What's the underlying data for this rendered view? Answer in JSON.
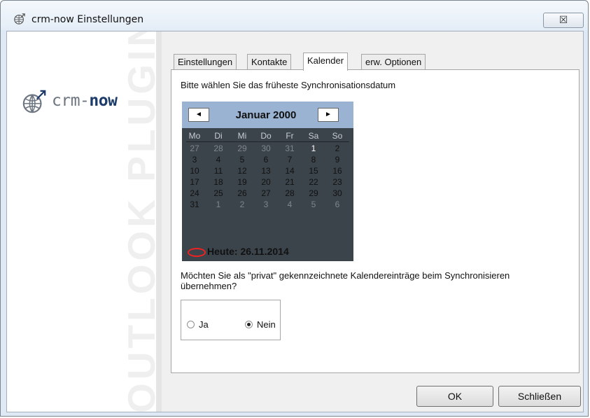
{
  "window": {
    "title": "crm-now Einstellungen",
    "close_glyph": "☒"
  },
  "sidebar": {
    "logo_text_main": "crm-",
    "logo_text_bold": "now",
    "vertical_text": "OUTLOOK PLUGIN",
    "logo_icon": "globe-arrow-icon"
  },
  "tabs": [
    {
      "label": "Einstellungen",
      "active": false
    },
    {
      "label": "Kontakte",
      "active": false
    },
    {
      "label": "Kalender",
      "active": true
    },
    {
      "label": "erw. Optionen",
      "active": false
    }
  ],
  "calendar_section": {
    "prompt": "Bitte wählen Sie das früheste Synchronisationsdatum",
    "month_label": "Januar 2000",
    "prev_glyph": "◄",
    "next_glyph": "►",
    "weekdays": [
      "Mo",
      "Di",
      "Mi",
      "Do",
      "Fr",
      "Sa",
      "So"
    ],
    "weeks": [
      [
        "27",
        "28",
        "29",
        "30",
        "31",
        "1",
        "2"
      ],
      [
        "3",
        "4",
        "5",
        "6",
        "7",
        "8",
        "9"
      ],
      [
        "10",
        "11",
        "12",
        "13",
        "14",
        "15",
        "16"
      ],
      [
        "17",
        "18",
        "19",
        "20",
        "21",
        "22",
        "23"
      ],
      [
        "24",
        "25",
        "26",
        "27",
        "28",
        "29",
        "30"
      ],
      [
        "31",
        "1",
        "2",
        "3",
        "4",
        "5",
        "6"
      ]
    ],
    "selected_date": "1",
    "today_label": "Heute: 26.11.2014",
    "colors": {
      "background": "#3b434b",
      "header": "#9ab3d2",
      "today_marker": "#e22222"
    }
  },
  "private_section": {
    "prompt": "Möchten Sie als \"privat\" gekennzeichnete Kalendereinträge beim Synchronisieren übernehmen?",
    "options": [
      {
        "label": "Ja",
        "checked": false
      },
      {
        "label": "Nein",
        "checked": true
      }
    ]
  },
  "buttons": {
    "ok_label": "OK",
    "close_label": "Schließen"
  }
}
